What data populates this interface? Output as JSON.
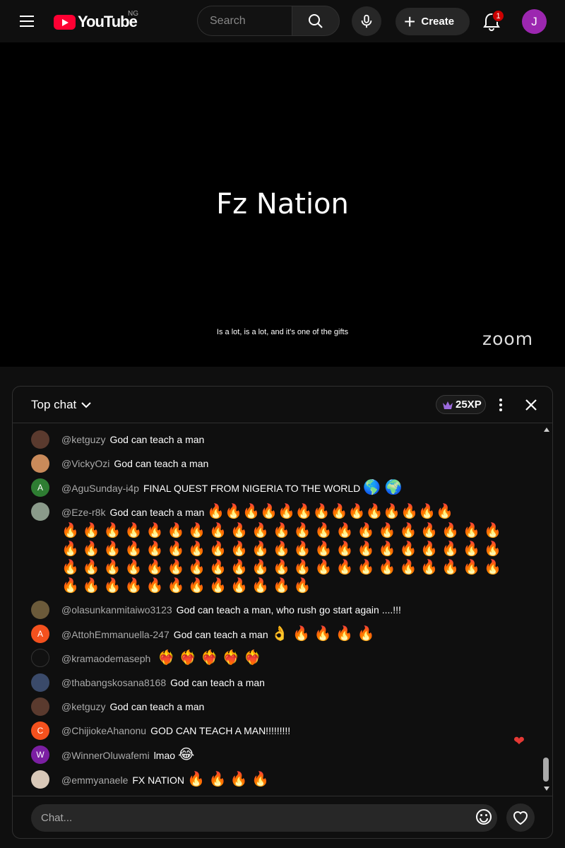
{
  "header": {
    "logo_text": "YouTube",
    "country": "NG",
    "search_placeholder": "Search",
    "create_label": "Create",
    "notification_count": "1",
    "avatar_letter": "J"
  },
  "player": {
    "title": "Fz Nation",
    "caption": "Is a lot, is a lot, and it's one of the gifts",
    "watermark": "zoom"
  },
  "chat": {
    "mode_label": "Top chat",
    "xp_label": "25XP",
    "input_placeholder": "Chat...",
    "messages": [
      {
        "author": "@ketguzy",
        "text": "God can teach a man",
        "emoji": "",
        "avatar_color": "#5a3a2e",
        "avatar_letter": ""
      },
      {
        "author": "@VickyOzi",
        "text": "God can teach a man",
        "emoji": "",
        "avatar_color": "#c98a5a",
        "avatar_letter": ""
      },
      {
        "author": "@AguSunday-i4p",
        "text": "FINAL QUEST FROM NIGERIA TO THE WORLD",
        "emoji": "🌎 🌍",
        "avatar_color": "#2e7d32",
        "avatar_letter": "A"
      },
      {
        "author": "@Eze-r8k",
        "text": "God can teach a man",
        "emoji": "🔥🔥🔥🔥🔥🔥🔥🔥🔥🔥🔥🔥🔥🔥",
        "avatar_color": "#8a9a8a",
        "avatar_letter": ""
      },
      {
        "author": "@olasunkanmitaiwo3123",
        "text": "God can teach a man, who rush go start again ....!!!",
        "emoji": "",
        "avatar_color": "#6b5a3a",
        "avatar_letter": ""
      },
      {
        "author": "@AttohEmmanuella-247",
        "text": "God can teach a man",
        "emoji": "👌 🔥 🔥 🔥 🔥",
        "avatar_color": "#f4511e",
        "avatar_letter": "A"
      },
      {
        "author": "@kramaodemaseph",
        "text": "",
        "emoji": "❤️‍🔥 ❤️‍🔥 ❤️‍🔥 ❤️‍🔥 ❤️‍🔥",
        "avatar_color": "#111111",
        "avatar_letter": ""
      },
      {
        "author": "@thabangskosana8168",
        "text": "God can teach a man",
        "emoji": "",
        "avatar_color": "#3a4a6a",
        "avatar_letter": ""
      },
      {
        "author": "@ketguzy",
        "text": "God can teach a man",
        "emoji": "",
        "avatar_color": "#5a3a2e",
        "avatar_letter": ""
      },
      {
        "author": "@ChijiokeAhanonu",
        "text": "GOD CAN TEACH A MAN!!!!!!!!!",
        "emoji": "",
        "avatar_color": "#f4511e",
        "avatar_letter": "C"
      },
      {
        "author": "@WinnerOluwafemi",
        "text": "lmao",
        "emoji": "😂",
        "avatar_color": "#7b1fa2",
        "avatar_letter": "W"
      },
      {
        "author": "@emmyanaele",
        "text": "FX NATION",
        "emoji": "🔥 🔥 🔥 🔥",
        "avatar_color": "#d8c8b8",
        "avatar_letter": ""
      }
    ],
    "fire_rows": [
      "🔥🔥🔥🔥🔥🔥🔥🔥🔥🔥🔥🔥🔥🔥🔥🔥🔥🔥🔥🔥🔥",
      "🔥🔥🔥🔥🔥🔥🔥🔥🔥🔥🔥🔥🔥🔥🔥🔥🔥🔥🔥🔥🔥",
      "🔥🔥🔥🔥🔥🔥🔥🔥🔥🔥🔥🔥🔥🔥🔥🔥🔥🔥🔥🔥🔥",
      "🔥🔥🔥🔥🔥🔥🔥🔥🔥🔥🔥🔥"
    ]
  }
}
